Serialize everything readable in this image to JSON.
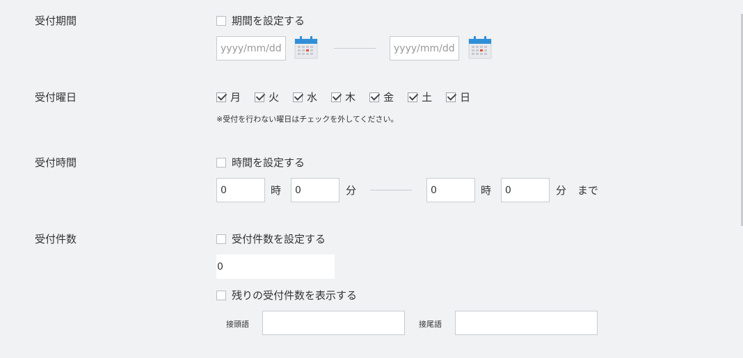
{
  "period": {
    "label": "受付期間",
    "checkbox_label": "期間を設定する",
    "start_placeholder": "yyyy/mm/dd",
    "end_placeholder": "yyyy/mm/dd",
    "icon": "calendar-icon"
  },
  "weekday": {
    "label": "受付曜日",
    "days": [
      "月",
      "火",
      "水",
      "木",
      "金",
      "土",
      "日"
    ],
    "note": "※受付を行わない曜日はチェックを外してください。"
  },
  "time": {
    "label": "受付時間",
    "checkbox_label": "時間を設定する",
    "start_hour": "0",
    "start_min": "0",
    "end_hour": "0",
    "end_min": "0",
    "hour_unit": "時",
    "min_unit": "分",
    "until": "まで"
  },
  "count": {
    "label": "受付件数",
    "checkbox_label": "受付件数を設定する",
    "value": "0",
    "remaining_label": "残りの受付件数を表示する",
    "prefix_label": "接頭語",
    "suffix_label": "接尾語",
    "prefix_value": "",
    "suffix_value": ""
  },
  "colors": {
    "background": "#f0f2f4",
    "calendar_blue": "#2f8fd8",
    "calendar_red": "#e0503c"
  }
}
